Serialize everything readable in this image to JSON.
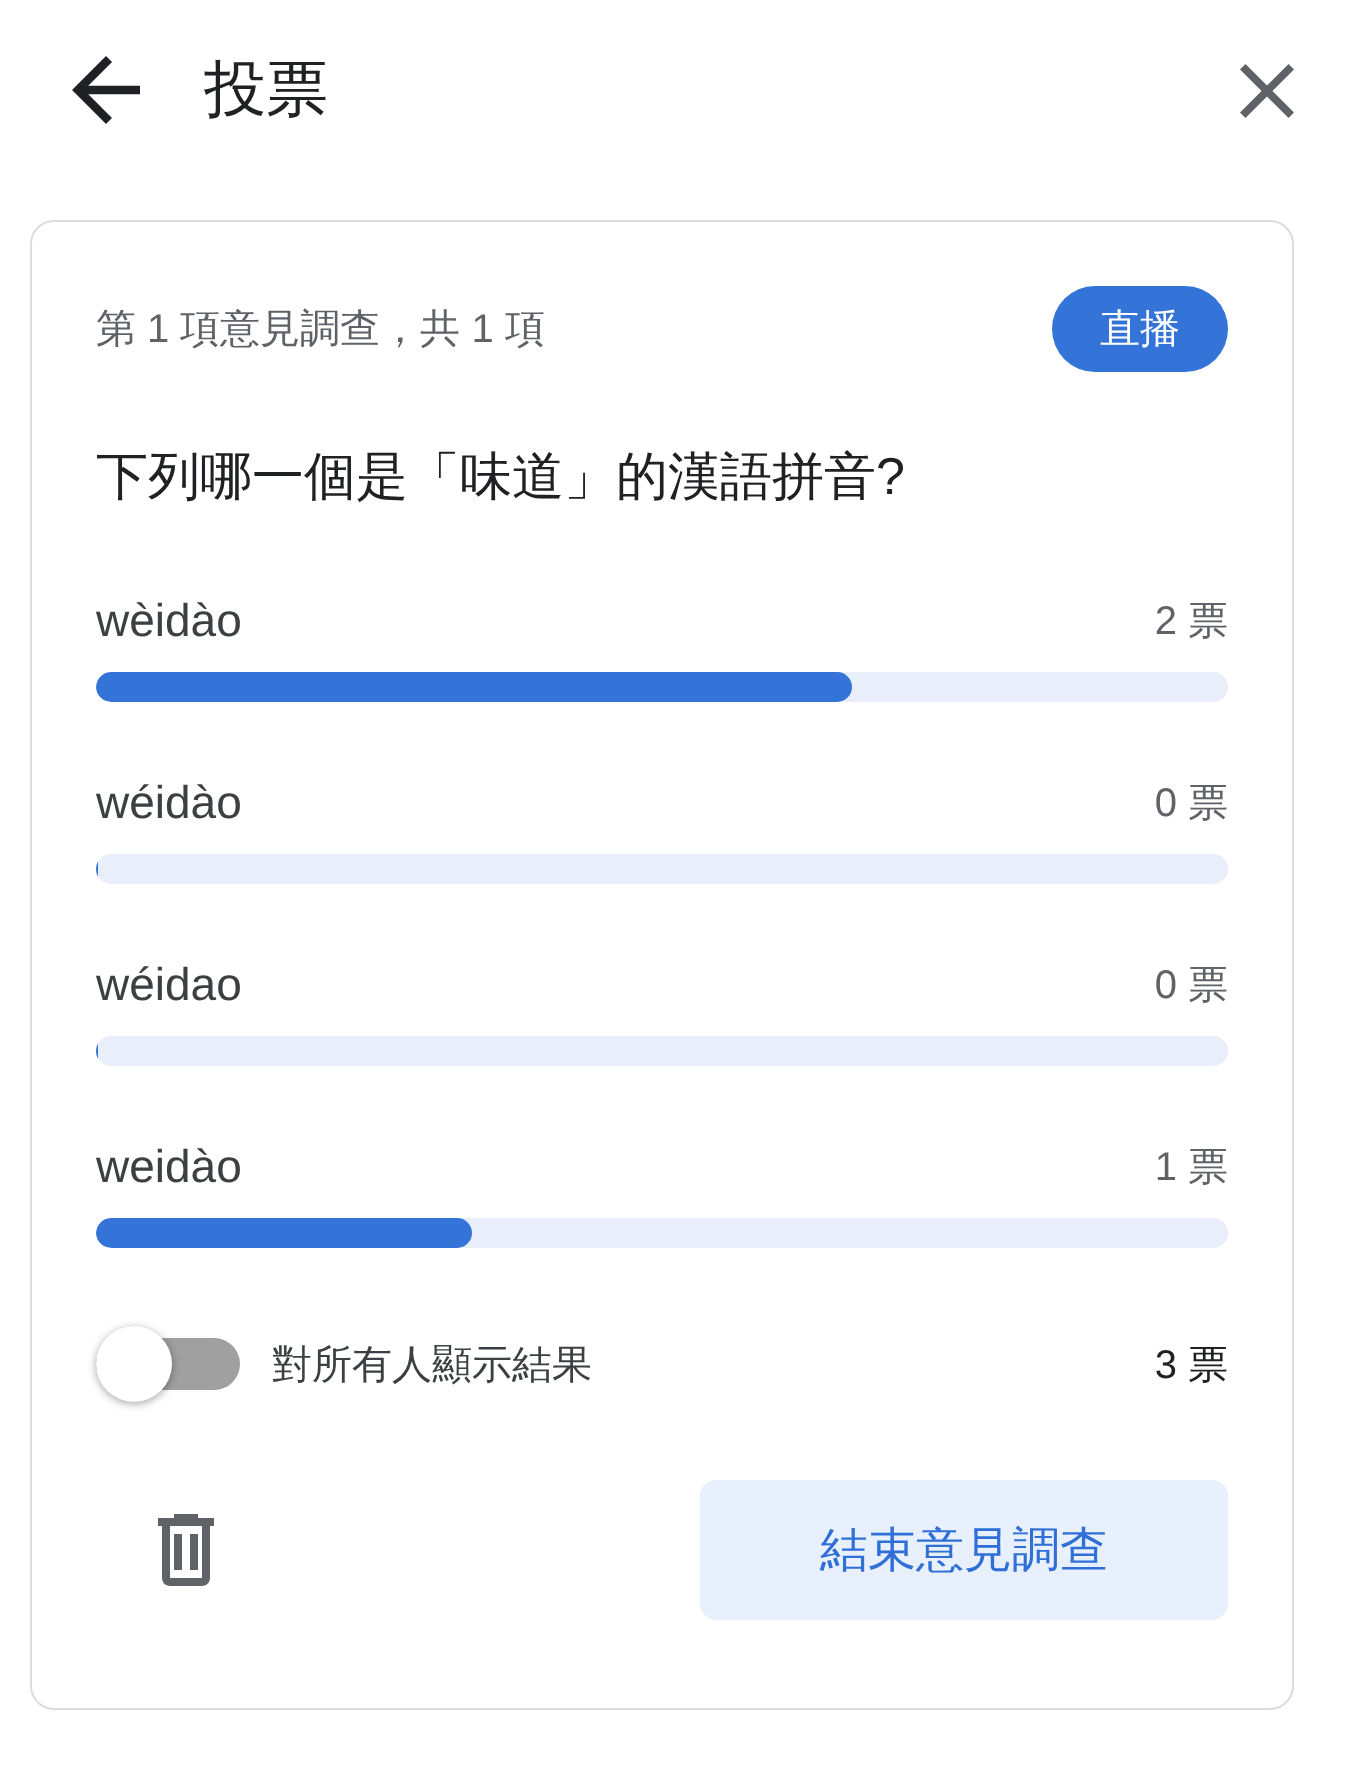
{
  "header": {
    "title": "投票"
  },
  "poll": {
    "position": "第 1 項意見調查，共 1 項",
    "badge": "直播",
    "question": "下列哪一個是「味道」的漢語拼音?",
    "options": [
      {
        "label": "wèidào",
        "votes": "2 票",
        "level": 0.667
      },
      {
        "label": "wéidào",
        "votes": "0 票",
        "level": 0
      },
      {
        "label": "wéidao",
        "votes": "0 票",
        "level": 0
      },
      {
        "label": "weidào",
        "votes": "1 票",
        "level": 0.333
      }
    ],
    "show_results": {
      "label": "對所有人顯示結果",
      "on": false
    },
    "total": "3 票",
    "end_button": "結束意見調查"
  }
}
